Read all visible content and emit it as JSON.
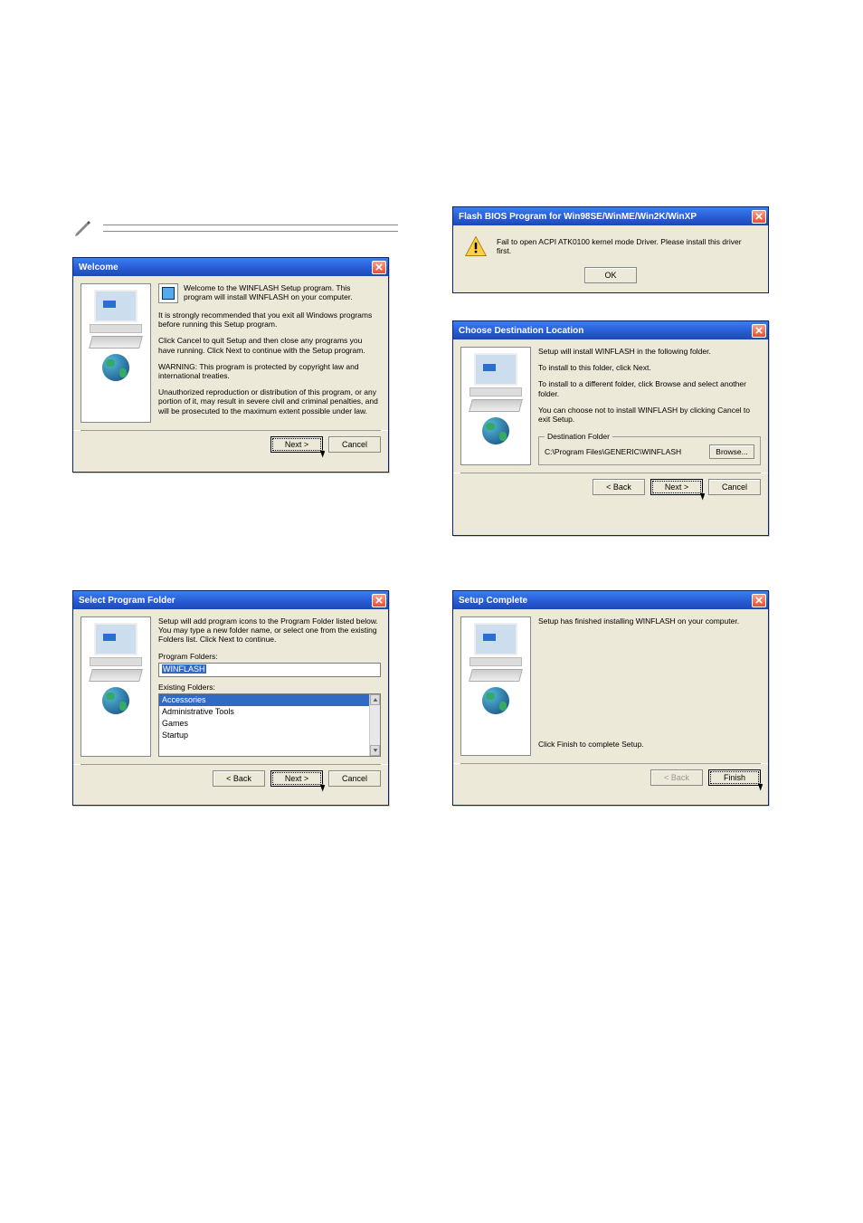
{
  "note": {
    "present": true
  },
  "error_dialog": {
    "title": "Flash BIOS Program for Win98SE/WinME/Win2K/WinXP",
    "message": "Fail to open ACPI ATK0100 kernel mode Driver. Please install this driver first.",
    "ok": "OK"
  },
  "welcome": {
    "title": "Welcome",
    "intro": "Welcome to the WINFLASH Setup program.  This program will install WINFLASH on your computer.",
    "line2": "It is strongly recommended that you exit all Windows programs before running this Setup program.",
    "line3": "Click Cancel to quit Setup and then close any programs you have running.  Click Next to continue with the Setup program.",
    "line4": "WARNING: This program is protected by copyright law and international treaties.",
    "line5": "Unauthorized reproduction or distribution of this program, or any portion of it, may result in severe civil and criminal penalties, and will be prosecuted to the maximum extent possible under law.",
    "next": "Next >",
    "cancel": "Cancel"
  },
  "dest": {
    "title": "Choose Destination Location",
    "line1": "Setup will install WINFLASH in the following folder.",
    "line2": "To install to this folder, click Next.",
    "line3": "To install to a different folder, click Browse and select another folder.",
    "line4": "You can choose not to install WINFLASH by clicking Cancel to exit Setup.",
    "group_label": "Destination Folder",
    "path": "C:\\Program Files\\GENERIC\\WINFLASH",
    "browse": "Browse...",
    "back": "< Back",
    "next": "Next >",
    "cancel": "Cancel"
  },
  "select_folder": {
    "title": "Select Program Folder",
    "line1": "Setup will add program icons to the Program Folder listed below. You may type a new folder name, or select one from the existing Folders list.  Click Next to continue.",
    "pf_label": "Program Folders:",
    "pf_value": "WINFLASH",
    "ef_label": "Existing Folders:",
    "items": [
      "Accessories",
      "Administrative Tools",
      "Games",
      "Startup"
    ],
    "back": "< Back",
    "next": "Next >",
    "cancel": "Cancel"
  },
  "complete": {
    "title": "Setup Complete",
    "line1": "Setup has finished installing WINFLASH on your computer.",
    "line2": "Click Finish to complete Setup.",
    "back": "< Back",
    "finish": "Finish"
  }
}
